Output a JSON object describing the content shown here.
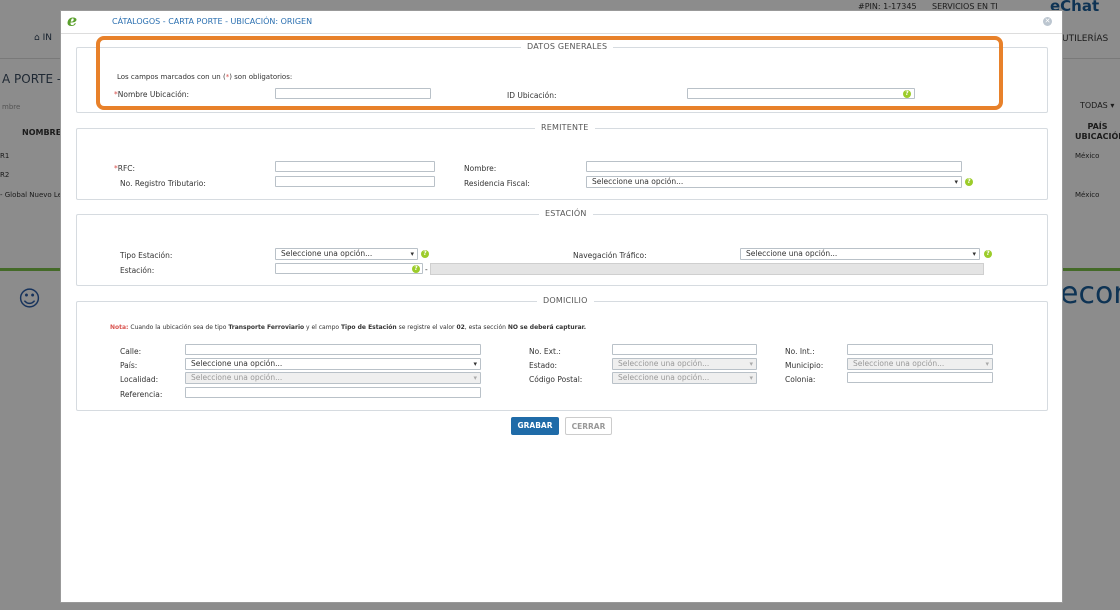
{
  "background": {
    "pin": "#PIN: 1-17345",
    "services": "SERVICIOS EN TI",
    "echat": "eChat",
    "home": "IN",
    "utilities": "UTILERÍAS",
    "page_title": "A PORTE - UB",
    "filter_placeholder": "mbre",
    "todas": "TODAS",
    "col_nombre": "NOMBRE",
    "col_pais": "PAÍS UBICACIÓN",
    "rows": [
      {
        "name": "R1",
        "pais": "México"
      },
      {
        "name": "R2",
        "pais": ""
      },
      {
        "name": "- Global Nuevo Le",
        "pais": "México"
      }
    ],
    "brand_right": "econ"
  },
  "modal": {
    "title": "CÁTALOGOS - CARTA PORTE - UBICACIÓN: ORIGEN",
    "close_icon": "close-x"
  },
  "datos_generales": {
    "legend": "DATOS GENERALES",
    "required_note_pre": "Los campos marcados con un (",
    "required_note_star": "*",
    "required_note_post": ") son obligatorios:",
    "nombre_label": "Nombre Ubicación:",
    "nombre_value": "",
    "id_label": "ID Ubicación:",
    "id_value": ""
  },
  "remitente": {
    "legend": "REMITENTE",
    "rfc_label": "RFC:",
    "rfc_value": "",
    "nombre_label": "Nombre:",
    "nombre_value": "",
    "registro_label": "No. Registro Tributario:",
    "registro_value": "",
    "residencia_label": "Residencia Fiscal:",
    "residencia_value": "Seleccione una opción..."
  },
  "estacion": {
    "legend": "ESTACIÓN",
    "tipo_label": "Tipo Estación:",
    "tipo_value": "Seleccione una opción...",
    "navegacion_label": "Navegación Tráfico:",
    "navegacion_value": "Seleccione una opción...",
    "estacion_label": "Estación:",
    "estacion_value": "",
    "dash": "-"
  },
  "domicilio": {
    "legend": "DOMICILIO",
    "note_label": "Nota:",
    "note_1": " Cuando la ubicación sea de tipo ",
    "note_bold_1": "Transporte Ferroviario",
    "note_2": " y el campo ",
    "note_bold_2": "Tipo de Estación",
    "note_3": " se registre el valor ",
    "note_bold_3": "02",
    "note_4": ", esta sección ",
    "note_bold_4": "NO se deberá capturar.",
    "calle_label": "Calle:",
    "next_label": "No. Ext.:",
    "nint_label": "No. Int.:",
    "pais_label": "País:",
    "pais_value": "Seleccione una opción...",
    "estado_label": "Estado:",
    "estado_value": "Seleccione una opción...",
    "municipio_label": "Municipio:",
    "municipio_value": "Seleccione una opción...",
    "localidad_label": "Localidad:",
    "localidad_value": "Seleccione una opción...",
    "cp_label": "Código Postal:",
    "cp_value": "Seleccione una opción...",
    "colonia_label": "Colonia:",
    "referencia_label": "Referencia:"
  },
  "buttons": {
    "grabar": "GRABAR",
    "cerrar": "CERRAR"
  },
  "colors": {
    "highlight": "#e8812a",
    "primary": "#1f6ba8",
    "help": "#9ccc2a",
    "required": "#d9534f"
  }
}
